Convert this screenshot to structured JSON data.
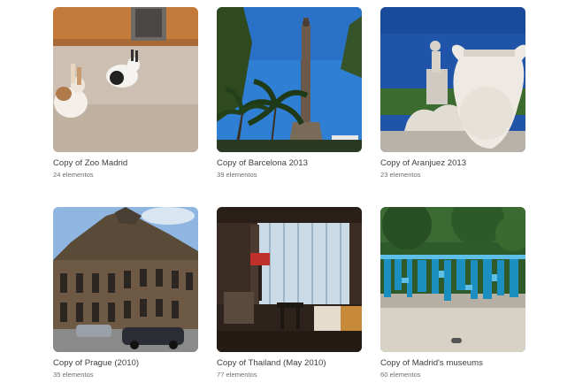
{
  "albums": [
    {
      "title": "Copy of Zoo Madrid",
      "count": "24 elementos",
      "thumbnail_icon": "rabbits-photo"
    },
    {
      "title": "Copy of Barcelona 2013",
      "count": "39 elementos",
      "thumbnail_icon": "columbus-monument-photo"
    },
    {
      "title": "Copy of Aranjuez 2013",
      "count": "23 elementos",
      "thumbnail_icon": "fountain-urn-photo"
    },
    {
      "title": "Copy of Prague (2010)",
      "count": "35 elementos",
      "thumbnail_icon": "theatre-building-photo"
    },
    {
      "title": "Copy of Thailand (May 2010)",
      "count": "77 elementos",
      "thumbnail_icon": "hotel-room-photo"
    },
    {
      "title": "Copy of Madrid's museums",
      "count": "60 elementos",
      "thumbnail_icon": "blue-sculpture-photo"
    }
  ]
}
